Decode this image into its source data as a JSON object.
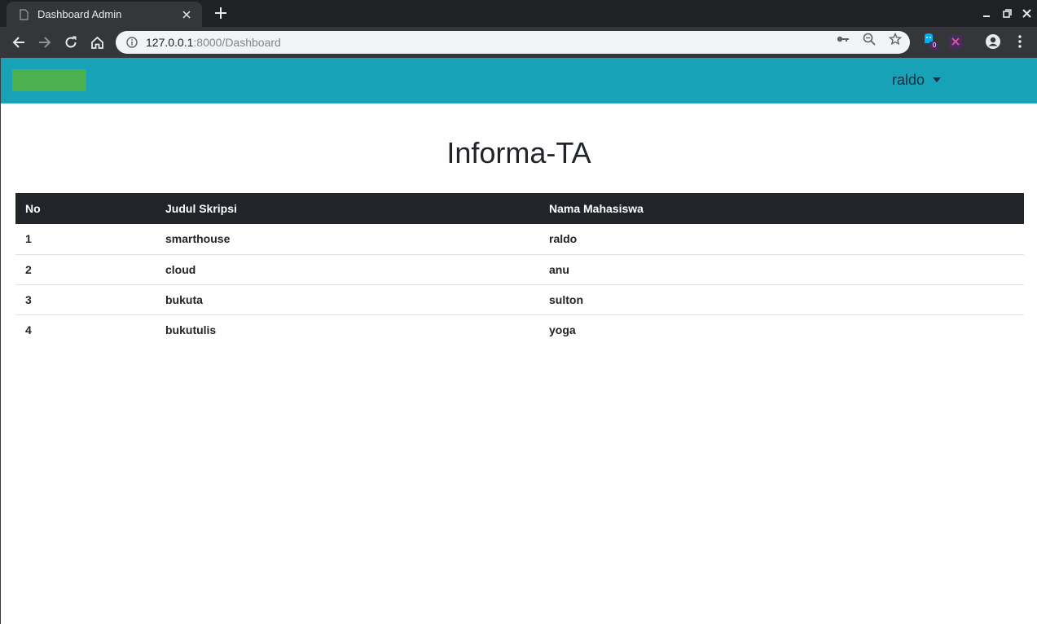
{
  "browser": {
    "tab_title": "Dashboard Admin",
    "url_host": "127.0.0.1",
    "url_path": ":8000/Dashboard",
    "extension_badge": "0"
  },
  "navbar": {
    "user_name": "raldo",
    "brand_color": "#4caf50",
    "bar_color": "#17a2b8"
  },
  "main": {
    "title": "Informa-TA",
    "table": {
      "headers": [
        "No",
        "Judul Skripsi",
        "Nama Mahasiswa"
      ],
      "rows": [
        [
          "1",
          "smarthouse",
          "raldo"
        ],
        [
          "2",
          "cloud",
          "anu"
        ],
        [
          "3",
          "bukuta",
          "sulton"
        ],
        [
          "4",
          "bukutulis",
          "yoga"
        ]
      ]
    }
  }
}
